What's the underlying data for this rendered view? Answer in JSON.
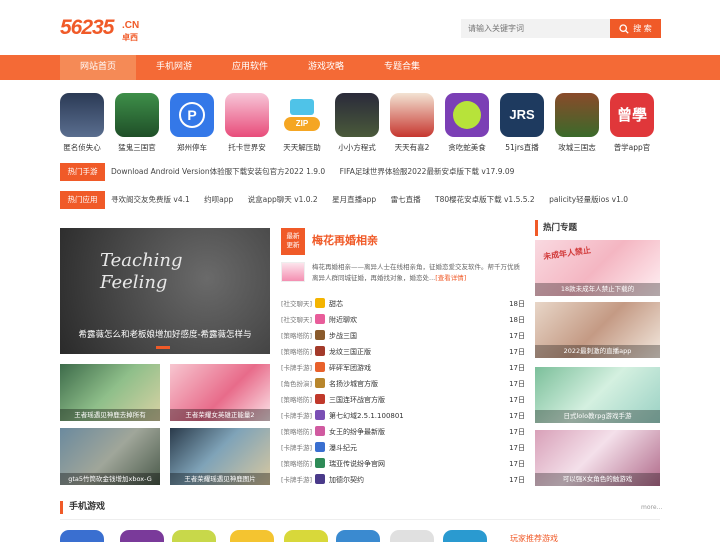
{
  "header": {
    "logo": {
      "num": "56235",
      "cn": ".CN",
      "zhuo": "卓西"
    },
    "search": {
      "placeholder": "请输入关键字词",
      "button_label": "搜 索"
    }
  },
  "nav": {
    "items": [
      {
        "label": "网站首页",
        "active": true
      },
      {
        "label": "手机网游",
        "active": false
      },
      {
        "label": "应用软件",
        "active": false
      },
      {
        "label": "游戏攻略",
        "active": false
      },
      {
        "label": "专题合集",
        "active": false
      }
    ]
  },
  "apps": [
    {
      "name": "匿名侦失心",
      "color": "#3a4a6b"
    },
    {
      "name": "猛鬼三国官",
      "color": "#2f7d3b"
    },
    {
      "name": "郑州停车",
      "color": "#3478e8"
    },
    {
      "name": "托卡世界安",
      "color": "#e84c7a"
    },
    {
      "name": "天天解压助",
      "color": "#4fc3e8"
    },
    {
      "name": "小小方程式",
      "color": "#2a2a3a"
    },
    {
      "name": "天天有喜2",
      "color": "#c6362f"
    },
    {
      "name": "贪吃蛇美食",
      "color": "#7b3fb5"
    },
    {
      "name": "51jrs直播",
      "color": "#1e3a5f"
    },
    {
      "name": "攻城三国志",
      "color": "#5a3a2a"
    },
    {
      "name": "曾学app官",
      "color": "#e0373a"
    }
  ],
  "hot_games": {
    "tag": "热门手游",
    "links": [
      "Download Android Version体验服下载安装包官方2022 1.9.0",
      "FIFA足球世界体验服2022最新安卓版下载 v17.9.09"
    ]
  },
  "hot_apps": {
    "tag": "热门应用",
    "links": [
      "寻欢阁交友免费版 v4.1",
      "约呗app",
      "说盒app聊天 v1.0.2",
      "星月直播app",
      "雷七直播",
      "T80樱花安卓版下载 v1.5.5.2",
      "palicity轻量版ios v1.0"
    ]
  },
  "slider": {
    "caption": "希露薇怎么和老板娘增加好感度-希露薇怎样与",
    "art_text": "Teaching Feeling"
  },
  "thumbs": [
    {
      "caption": "王者瑶遇见神鹿去掉所有"
    },
    {
      "caption": "王者荣耀女英雄正能量2"
    },
    {
      "caption": "gta5竹筒砍金钱增加xbox-G"
    },
    {
      "caption": "王者荣耀瑶遇见神鹿图片"
    }
  ],
  "feature": {
    "badge_line1": "最新",
    "badge_line2": "更新",
    "title": "梅花再婚相亲",
    "desc": "梅花再婚相亲——离异人士在线相亲角，征婚恋爱交友软件。帮千万优质离异人群同城征婚，再婚找对象，婚恋处...",
    "more": "[查看详情]"
  },
  "list": [
    {
      "cat": "[社交聊天]",
      "name": "甜芯",
      "date": "18日",
      "color": "#f4b400"
    },
    {
      "cat": "[社交聊天]",
      "name": "附近聊欢",
      "date": "18日",
      "color": "#e85d9a"
    },
    {
      "cat": "[策略塔防]",
      "name": "步战三国",
      "date": "17日",
      "color": "#8a5a2b"
    },
    {
      "cat": "[策略塔防]",
      "name": "龙纹三国正版",
      "date": "17日",
      "color": "#a33a2a"
    },
    {
      "cat": "[卡牌手游]",
      "name": "砰砰军团游戏",
      "date": "17日",
      "color": "#e8612c"
    },
    {
      "cat": "[角色扮演]",
      "name": "名扬沙城官方版",
      "date": "17日",
      "color": "#b8862c"
    },
    {
      "cat": "[策略塔防]",
      "name": "三国连环战官方版",
      "date": "17日",
      "color": "#c0392b"
    },
    {
      "cat": "[卡牌手游]",
      "name": "第七幻域2.5.1.100801",
      "date": "17日",
      "color": "#7a4fb5"
    },
    {
      "cat": "[策略塔防]",
      "name": "女王的纷争最新版",
      "date": "17日",
      "color": "#d05aa0"
    },
    {
      "cat": "[卡牌手游]",
      "name": "瀑斗纪元",
      "date": "17日",
      "color": "#3a6fd0"
    },
    {
      "cat": "[策略塔防]",
      "name": "瑞亚传说纷争官网",
      "date": "17日",
      "color": "#2e8b57"
    },
    {
      "cat": "[卡牌手游]",
      "name": "加德尔契约",
      "date": "17日",
      "color": "#4a3a8a"
    }
  ],
  "hot_topics": {
    "title": "热门专题",
    "items": [
      {
        "caption": "18款未成年人禁止下载的",
        "banner": "未成年人禁止"
      },
      {
        "caption": "2022最刺激的直播app"
      },
      {
        "caption": "日式lolo教rpg游戏手游"
      },
      {
        "caption": "可以强X女角色的触游戏"
      }
    ]
  },
  "mobile_games": {
    "title": "手机游戏",
    "more": "more...",
    "recommend": "玩家推荐游戏"
  },
  "colors": {
    "accent": "#f05a28",
    "nav": "#f46a36"
  }
}
